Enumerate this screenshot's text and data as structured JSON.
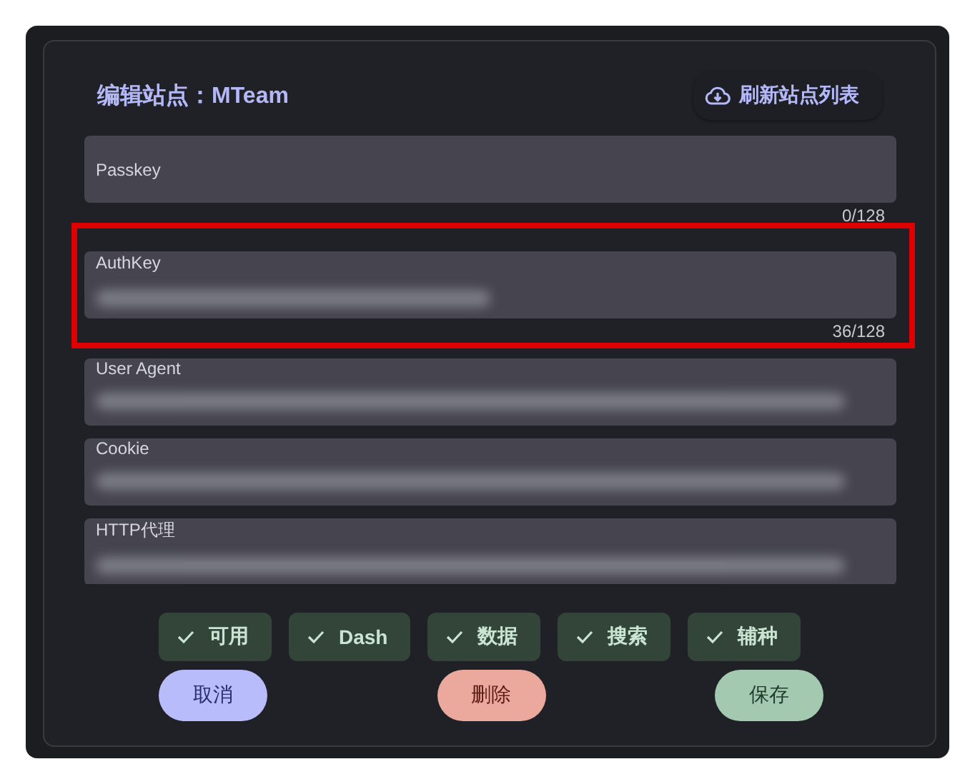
{
  "dialog": {
    "title": "编辑站点：MTeam",
    "refresh_button": "刷新站点列表"
  },
  "fields": [
    {
      "label": "Passkey",
      "blurred": false,
      "counter": "0/128",
      "highlighted": false
    },
    {
      "label": "AuthKey",
      "blurred": true,
      "counter": "36/128",
      "highlighted": true
    },
    {
      "label": "User Agent",
      "blurred": true,
      "highlighted": false
    },
    {
      "label": "Cookie",
      "blurred": true,
      "highlighted": false
    },
    {
      "label": "HTTP代理",
      "blurred": true,
      "highlighted": false
    }
  ],
  "toggles": [
    {
      "label": "可用",
      "checked": true
    },
    {
      "label": "Dash",
      "checked": true
    },
    {
      "label": "数据",
      "checked": true
    },
    {
      "label": "搜索",
      "checked": true
    },
    {
      "label": "辅种",
      "checked": true
    }
  ],
  "buttons": [
    {
      "label": "取消",
      "kind": "cancel"
    },
    {
      "label": "删除",
      "kind": "delete"
    },
    {
      "label": "保存",
      "kind": "save"
    }
  ]
}
